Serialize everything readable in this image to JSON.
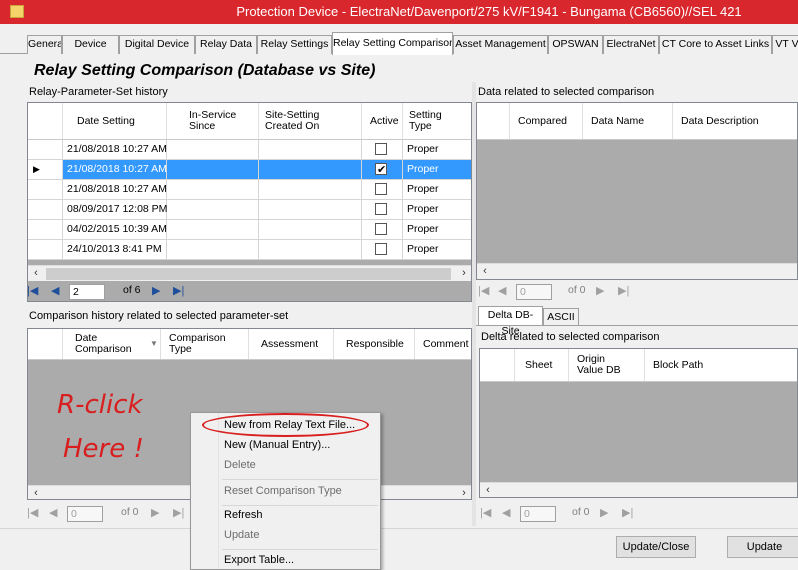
{
  "window": {
    "title": "Protection Device - ElectraNet/Davenport/275 kV/F1941 - Bungama (CB6560)//SEL 421"
  },
  "tabs": [
    {
      "label": "General"
    },
    {
      "label": "Device"
    },
    {
      "label": "Digital Device"
    },
    {
      "label": "Relay Data"
    },
    {
      "label": "Relay Settings"
    },
    {
      "label": "Relay Setting Comparison"
    },
    {
      "label": "Asset Management"
    },
    {
      "label": "OPSWAN"
    },
    {
      "label": "ElectraNet"
    },
    {
      "label": "CT Core to Asset Links"
    },
    {
      "label": "VT V"
    }
  ],
  "page_title": "Relay Setting Comparison (Database vs Site)",
  "history": {
    "label": "Relay-Parameter-Set history",
    "columns": [
      "Date Setting",
      "In-Service\nSince",
      "Site-Setting\nCreated On",
      "Active",
      "Setting\nType"
    ],
    "rows": [
      {
        "date": "21/08/2018 10:27 AM",
        "in_service": "",
        "site_created": "",
        "active": false,
        "type": "Proper",
        "selected": false
      },
      {
        "date": "21/08/2018 10:27 AM",
        "in_service": "",
        "site_created": "",
        "active": true,
        "type": "Proper",
        "selected": true
      },
      {
        "date": "21/08/2018 10:27 AM",
        "in_service": "",
        "site_created": "",
        "active": false,
        "type": "Proper",
        "selected": false
      },
      {
        "date": "08/09/2017 12:08 PM",
        "in_service": "",
        "site_created": "",
        "active": false,
        "type": "Proper",
        "selected": false
      },
      {
        "date": "04/02/2015 10:39 AM",
        "in_service": "",
        "site_created": "",
        "active": false,
        "type": "Proper",
        "selected": false
      },
      {
        "date": "24/10/2013 8:41 PM",
        "in_service": "",
        "site_created": "",
        "active": false,
        "type": "Proper",
        "selected": false
      }
    ],
    "nav": {
      "page": "2",
      "of": "of 6"
    }
  },
  "comparison_data": {
    "label": "Data related to selected comparison",
    "columns": [
      "Compared",
      "Data Name",
      "Data Description"
    ],
    "nav": {
      "page": "0",
      "of": "of 0"
    }
  },
  "comparison_history": {
    "label": "Comparison history related to selected parameter-set",
    "columns": [
      "Date\nComparison",
      "Comparison\nType",
      "Assessment",
      "Responsible",
      "Comment"
    ],
    "nav": {
      "page": "0",
      "of": "of 0"
    }
  },
  "delta": {
    "subtabs": [
      "Delta DB-Site",
      "ASCII"
    ],
    "label": "Delta related to selected comparison",
    "columns": [
      "Sheet",
      "Origin\nValue DB",
      "Block Path"
    ],
    "nav": {
      "page": "0",
      "of": "of 0"
    }
  },
  "annotation": {
    "line1": "R-click",
    "line2": "Here !"
  },
  "context_menu": {
    "items": [
      {
        "label": "New from Relay Text File...",
        "enabled": true
      },
      {
        "label": "New (Manual Entry)...",
        "enabled": true
      },
      {
        "label": "Delete",
        "enabled": false
      },
      {
        "label": "Reset Comparison Type",
        "enabled": false
      },
      {
        "label": "Refresh",
        "enabled": true
      },
      {
        "label": "Update",
        "enabled": false
      },
      {
        "label": "Export Table...",
        "enabled": true
      }
    ]
  },
  "buttons": {
    "update_close": "Update/Close",
    "update": "Update"
  },
  "colors": {
    "title_bar": "#d9272e",
    "selection": "#3399ff",
    "annotation": "#d81e1e"
  }
}
